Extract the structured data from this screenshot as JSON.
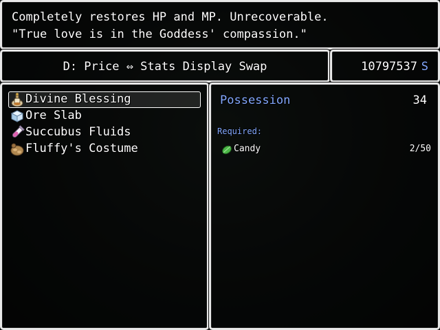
{
  "help": {
    "line1": "Completely restores HP and MP. Unrecoverable.",
    "line2": "\"True love is in the Goddess' compassion.\""
  },
  "command": {
    "label": "D: Price ⇔ Stats Display Swap"
  },
  "gold": {
    "amount": "10797537",
    "unit": "S"
  },
  "items": [
    {
      "name": "Divine Blessing",
      "icon": "potion-bottle-icon",
      "selected": true
    },
    {
      "name": "Ore Slab",
      "icon": "ice-block-icon",
      "selected": false
    },
    {
      "name": "Succubus Fluids",
      "icon": "test-tube-icon",
      "selected": false
    },
    {
      "name": "Fluffy's Costume",
      "icon": "fur-costume-icon",
      "selected": false
    }
  ],
  "status": {
    "possession_label": "Possession",
    "possession_value": "34",
    "required_label": "Required:",
    "required": [
      {
        "name": "Candy",
        "icon": "green-leaf-candy-icon",
        "count": "2/50"
      }
    ]
  },
  "colors": {
    "system_blue": "#84a9ff",
    "text": "#ffffff",
    "window_border": "#e8e8e8"
  }
}
